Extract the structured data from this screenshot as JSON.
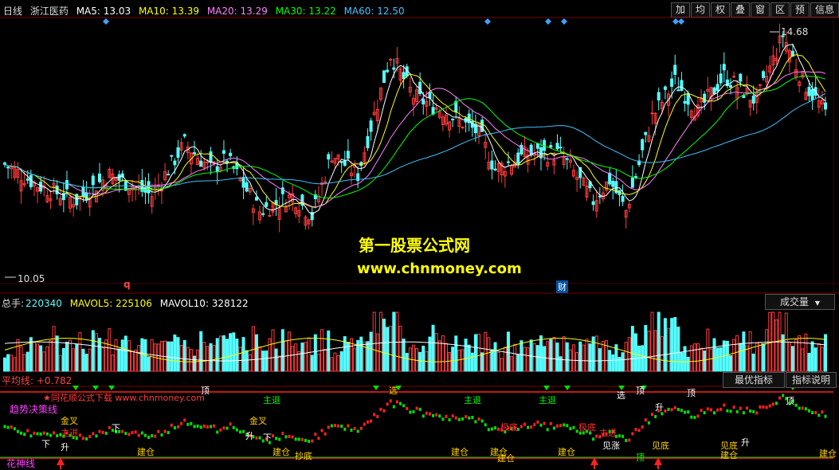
{
  "header": {
    "period": "日线",
    "stock": "浙江医药",
    "ma5": "MA5: 13.03",
    "ma10": "MA10: 13.39",
    "ma20": "MA20: 13.29",
    "ma30": "MA30: 13.22",
    "ma60": "MA60: 12.50"
  },
  "toolbar": [
    "加",
    "均",
    "权",
    "叠",
    "窗",
    "区",
    "预",
    "信息"
  ],
  "price": {
    "high_label": "14.68",
    "low_label": "10.05",
    "q_label": "q",
    "cai_label": "财"
  },
  "watermark": {
    "line1": "第一股票公式网",
    "line2": "www.chnmoney.com"
  },
  "volume": {
    "label": "总手:",
    "value": "220340",
    "mavol5": "MAVOL5: 225106",
    "mavol10": "MAVOL10: 328122",
    "dropdown": "成交量"
  },
  "indicator": {
    "label": "平均线:",
    "value": "+0.782",
    "btn_best": "最优指标",
    "btn_help": "指标说明",
    "source_text": "★同花顺公式下载  www.chnmoney.com",
    "trend_label": "趋势决策线",
    "god_label": "花神线",
    "annotations": [
      "下",
      "升",
      "金叉",
      "主进",
      "下",
      "金叉",
      "升",
      "下",
      "主退",
      "建仓",
      "建仓",
      "抄底",
      "顶",
      "主退",
      "选",
      "主退",
      "建仓",
      "极底",
      "极底",
      "主进",
      "见涨",
      "建仓",
      "建仓",
      "见底",
      "顶",
      "选",
      "升",
      "顶",
      "见底",
      "升",
      "顶",
      "建仓",
      "建仓",
      "顶",
      "建仓"
    ]
  },
  "colors": {
    "up": "#ff3b3b",
    "down": "#54ffff",
    "ma5": "#ffffff",
    "ma10": "#ffff00",
    "ma20": "#ff80ff",
    "ma30": "#00ff00",
    "ma60": "#40c0ff"
  }
}
